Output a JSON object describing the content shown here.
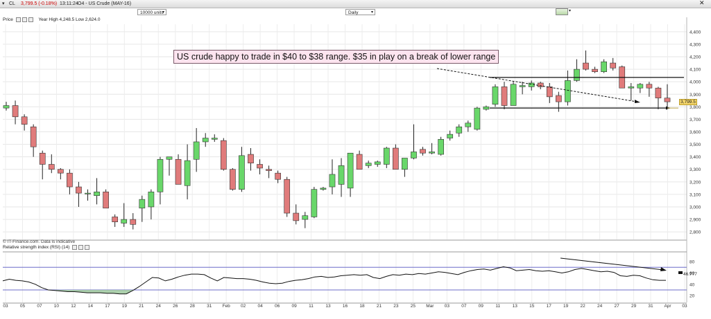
{
  "toolbar": {
    "symbol": "CL",
    "price_change": "3,799.5 (-0.18%)",
    "time": "13:11:24",
    "instrument": "O4 - US Crude (MAY-16)",
    "units_value": "10000 units",
    "period_value": "Daily"
  },
  "price_panel": {
    "label": "Price",
    "stats": "Year High 4,248.5 Low 2,624.0",
    "last_price_tag": "3,799.5",
    "watermark": "© IT-Finance.com. Data is indicative"
  },
  "annotation": "US crude happy to trade in $40 to $38 range. $35 in play on a break of lower range",
  "rsi_panel": {
    "label": "Relative strength index (RSI) (14)",
    "last_value": "46.777",
    "ticks": [
      "80",
      "60",
      "40",
      "20"
    ],
    "upper_band": 70,
    "lower_band": 30
  },
  "chart_data": {
    "type": "candlestick",
    "title": "",
    "y_ticks": [
      2800,
      2900,
      3000,
      3100,
      3200,
      3300,
      3400,
      3500,
      3600,
      3700,
      3800,
      3900,
      4000,
      4100,
      4200,
      4300,
      4400
    ],
    "y_tick_labels": [
      "2,800",
      "2,900",
      "3,000",
      "3,100",
      "3,200",
      "3,300",
      "3,400",
      "3,500",
      "3,600",
      "3,700",
      "3,800",
      "3,900",
      "4,000",
      "4,100",
      "4,200",
      "4,300",
      "4,400"
    ],
    "x_tick_labels": [
      "03",
      "05",
      "07",
      "10",
      "12",
      "14",
      "17",
      "19",
      "21",
      "24",
      "26",
      "28",
      "31",
      "Feb",
      "02",
      "04",
      "06",
      "09",
      "11",
      "13",
      "16",
      "18",
      "21",
      "23",
      "25",
      "Mar",
      "03",
      "07",
      "09",
      "11",
      "13",
      "15",
      "17",
      "19",
      "22",
      "24",
      "27",
      "29",
      "31",
      "Apr",
      "03"
    ],
    "colors": {
      "up": "#69d76a",
      "down": "#e07b7b",
      "line": "#000000",
      "band": "#6c6cc8",
      "oversold_fill": "#9ec89e"
    },
    "candles": [
      {
        "o": 3790,
        "h": 3840,
        "l": 3770,
        "c": 3810
      },
      {
        "o": 3810,
        "h": 3850,
        "l": 3660,
        "c": 3720
      },
      {
        "o": 3720,
        "h": 3740,
        "l": 3610,
        "c": 3660
      },
      {
        "o": 3640,
        "h": 3660,
        "l": 3400,
        "c": 3480
      },
      {
        "o": 3430,
        "h": 3450,
        "l": 3220,
        "c": 3340
      },
      {
        "o": 3340,
        "h": 3420,
        "l": 3270,
        "c": 3300
      },
      {
        "o": 3300,
        "h": 3310,
        "l": 3220,
        "c": 3270
      },
      {
        "o": 3270,
        "h": 3300,
        "l": 3100,
        "c": 3160
      },
      {
        "o": 3160,
        "h": 3200,
        "l": 3000,
        "c": 3110
      },
      {
        "o": 3110,
        "h": 3140,
        "l": 3050,
        "c": 3110
      },
      {
        "o": 3090,
        "h": 3230,
        "l": 3020,
        "c": 3120
      },
      {
        "o": 3120,
        "h": 3140,
        "l": 2990,
        "c": 2990
      },
      {
        "o": 2920,
        "h": 2940,
        "l": 2840,
        "c": 2880
      },
      {
        "o": 2870,
        "h": 3030,
        "l": 2840,
        "c": 2900
      },
      {
        "o": 2900,
        "h": 2950,
        "l": 2820,
        "c": 2860
      },
      {
        "o": 2990,
        "h": 3090,
        "l": 2880,
        "c": 3060
      },
      {
        "o": 3000,
        "h": 3140,
        "l": 2900,
        "c": 3120
      },
      {
        "o": 3120,
        "h": 3400,
        "l": 3020,
        "c": 3380
      },
      {
        "o": 3380,
        "h": 3390,
        "l": 3250,
        "c": 3400
      },
      {
        "o": 3380,
        "h": 3420,
        "l": 3200,
        "c": 3180
      },
      {
        "o": 3170,
        "h": 3500,
        "l": 3060,
        "c": 3370
      },
      {
        "o": 3380,
        "h": 3630,
        "l": 3280,
        "c": 3520
      },
      {
        "o": 3520,
        "h": 3590,
        "l": 3480,
        "c": 3550
      },
      {
        "o": 3540,
        "h": 3580,
        "l": 3520,
        "c": 3550
      },
      {
        "o": 3530,
        "h": 3550,
        "l": 3290,
        "c": 3300
      },
      {
        "o": 3300,
        "h": 3310,
        "l": 3130,
        "c": 3140
      },
      {
        "o": 3140,
        "h": 3480,
        "l": 3120,
        "c": 3410
      },
      {
        "o": 3420,
        "h": 3470,
        "l": 3290,
        "c": 3350
      },
      {
        "o": 3340,
        "h": 3380,
        "l": 3260,
        "c": 3310
      },
      {
        "o": 3300,
        "h": 3330,
        "l": 3230,
        "c": 3290
      },
      {
        "o": 3270,
        "h": 3290,
        "l": 3190,
        "c": 3220
      },
      {
        "o": 3220,
        "h": 3240,
        "l": 2920,
        "c": 2950
      },
      {
        "o": 2950,
        "h": 3020,
        "l": 2860,
        "c": 2890
      },
      {
        "o": 2900,
        "h": 2960,
        "l": 2830,
        "c": 2930
      },
      {
        "o": 2920,
        "h": 3160,
        "l": 2910,
        "c": 3140
      },
      {
        "o": 3140,
        "h": 3160,
        "l": 3130,
        "c": 3150
      },
      {
        "o": 3160,
        "h": 3380,
        "l": 3100,
        "c": 3260
      },
      {
        "o": 3180,
        "h": 3390,
        "l": 3080,
        "c": 3330
      },
      {
        "o": 3150,
        "h": 3400,
        "l": 3080,
        "c": 3430
      },
      {
        "o": 3420,
        "h": 3450,
        "l": 3320,
        "c": 3300
      },
      {
        "o": 3330,
        "h": 3370,
        "l": 3310,
        "c": 3350
      },
      {
        "o": 3340,
        "h": 3370,
        "l": 3320,
        "c": 3360
      },
      {
        "o": 3340,
        "h": 3480,
        "l": 3310,
        "c": 3470
      },
      {
        "o": 3470,
        "h": 3500,
        "l": 3320,
        "c": 3300
      },
      {
        "o": 3300,
        "h": 3390,
        "l": 3240,
        "c": 3390
      },
      {
        "o": 3390,
        "h": 3660,
        "l": 3380,
        "c": 3440
      },
      {
        "o": 3460,
        "h": 3480,
        "l": 3410,
        "c": 3430
      },
      {
        "o": 3430,
        "h": 3510,
        "l": 3420,
        "c": 3440
      },
      {
        "o": 3420,
        "h": 3560,
        "l": 3410,
        "c": 3540
      },
      {
        "o": 3550,
        "h": 3610,
        "l": 3530,
        "c": 3580
      },
      {
        "o": 3590,
        "h": 3660,
        "l": 3560,
        "c": 3640
      },
      {
        "o": 3640,
        "h": 3690,
        "l": 3600,
        "c": 3670
      },
      {
        "o": 3620,
        "h": 3800,
        "l": 3610,
        "c": 3790
      },
      {
        "o": 3780,
        "h": 3810,
        "l": 3770,
        "c": 3800
      },
      {
        "o": 3820,
        "h": 3980,
        "l": 3800,
        "c": 3960
      },
      {
        "o": 3960,
        "h": 4000,
        "l": 3780,
        "c": 3810
      },
      {
        "o": 3810,
        "h": 4000,
        "l": 3810,
        "c": 3980
      },
      {
        "o": 3960,
        "h": 4000,
        "l": 3900,
        "c": 3970
      },
      {
        "o": 3960,
        "h": 4010,
        "l": 3930,
        "c": 3990
      },
      {
        "o": 3990,
        "h": 4000,
        "l": 3940,
        "c": 3960
      },
      {
        "o": 3960,
        "h": 3990,
        "l": 3830,
        "c": 3880
      },
      {
        "o": 3890,
        "h": 3920,
        "l": 3760,
        "c": 3840
      },
      {
        "o": 3840,
        "h": 4090,
        "l": 3810,
        "c": 4010
      },
      {
        "o": 4010,
        "h": 4180,
        "l": 4000,
        "c": 4100
      },
      {
        "o": 4150,
        "h": 4250,
        "l": 4090,
        "c": 4100
      },
      {
        "o": 4100,
        "h": 4120,
        "l": 4070,
        "c": 4080
      },
      {
        "o": 4080,
        "h": 4180,
        "l": 4070,
        "c": 4160
      },
      {
        "o": 4150,
        "h": 4190,
        "l": 4090,
        "c": 4110
      },
      {
        "o": 4120,
        "h": 4130,
        "l": 3950,
        "c": 3950
      },
      {
        "o": 3950,
        "h": 3990,
        "l": 3850,
        "c": 3960
      },
      {
        "o": 3950,
        "h": 3990,
        "l": 3910,
        "c": 3980
      },
      {
        "o": 3980,
        "h": 4000,
        "l": 3880,
        "c": 3950
      },
      {
        "o": 3950,
        "h": 3960,
        "l": 3780,
        "c": 3870
      },
      {
        "o": 3870,
        "h": 3980,
        "l": 3790,
        "c": 3840
      }
    ],
    "resistance": 4035,
    "support": 3790,
    "rsi": [
      46,
      49,
      47,
      46,
      44,
      40,
      34,
      30,
      29,
      28,
      27,
      27,
      26,
      25,
      25,
      25,
      24,
      24,
      23,
      23,
      29,
      36,
      44,
      52,
      51,
      46,
      49,
      53,
      56,
      58,
      58,
      57,
      51,
      46,
      52,
      51,
      50,
      50,
      49,
      47,
      44,
      42,
      41,
      42,
      45,
      47,
      48,
      50,
      53,
      54,
      52,
      53,
      55,
      56,
      57,
      56,
      57,
      52,
      50,
      54,
      57,
      56,
      58,
      57,
      59,
      58,
      60,
      62,
      61,
      59,
      57,
      61,
      64,
      66,
      67,
      65,
      68,
      71,
      69,
      64,
      65,
      66,
      64,
      63,
      64,
      62,
      60,
      62,
      66,
      68,
      66,
      64,
      62,
      63,
      61,
      55,
      54,
      56,
      55,
      51,
      48,
      47,
      47
    ]
  }
}
